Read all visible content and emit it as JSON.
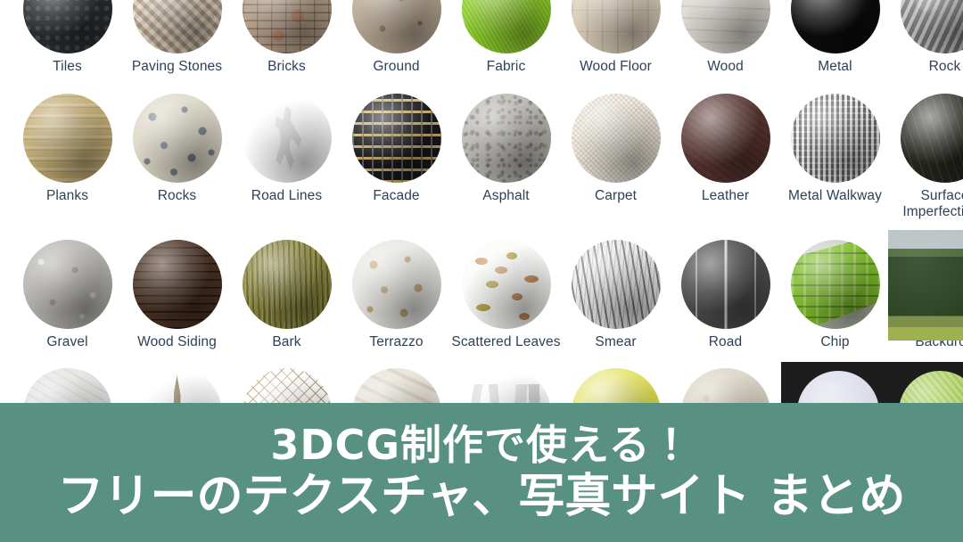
{
  "page": {
    "kind": "texture-library-grid-with-banner",
    "background_color": "#ffffff"
  },
  "grid": {
    "label_color": "#2d4159",
    "columns": 9,
    "items": [
      {
        "label": "Tiles",
        "texture": "t-tiles",
        "shape": "sphere",
        "col": 0,
        "row": 0
      },
      {
        "label": "Paving Stones",
        "texture": "t-paving",
        "shape": "sphere",
        "col": 1,
        "row": 0
      },
      {
        "label": "Bricks",
        "texture": "t-bricks",
        "shape": "sphere",
        "col": 2,
        "row": 0
      },
      {
        "label": "Ground",
        "texture": "t-ground",
        "shape": "sphere",
        "col": 3,
        "row": 0
      },
      {
        "label": "Fabric",
        "texture": "t-fabric",
        "shape": "sphere",
        "col": 4,
        "row": 0
      },
      {
        "label": "Wood Floor",
        "texture": "t-woodfloor",
        "shape": "sphere",
        "col": 5,
        "row": 0
      },
      {
        "label": "Wood",
        "texture": "t-wood",
        "shape": "sphere",
        "col": 6,
        "row": 0
      },
      {
        "label": "Metal",
        "texture": "t-metal",
        "shape": "sphere",
        "col": 7,
        "row": 0
      },
      {
        "label": "Rock",
        "texture": "t-rock",
        "shape": "sphere",
        "col": 8,
        "row": 0
      },
      {
        "label": "Planks",
        "texture": "t-planks",
        "shape": "sphere",
        "col": 0,
        "row": 1
      },
      {
        "label": "Rocks",
        "texture": "t-rocks",
        "shape": "sphere",
        "col": 1,
        "row": 1
      },
      {
        "label": "Road Lines",
        "texture": "t-roadlines",
        "shape": "sphere",
        "col": 2,
        "row": 1
      },
      {
        "label": "Facade",
        "texture": "t-facade",
        "shape": "sphere",
        "col": 3,
        "row": 1
      },
      {
        "label": "Asphalt",
        "texture": "t-asphalt",
        "shape": "sphere",
        "col": 4,
        "row": 1
      },
      {
        "label": "Carpet",
        "texture": "t-carpet",
        "shape": "sphere",
        "col": 5,
        "row": 1
      },
      {
        "label": "Leather",
        "texture": "t-leather",
        "shape": "sphere",
        "col": 6,
        "row": 1
      },
      {
        "label": "Metal Walkway",
        "texture": "t-walkway",
        "shape": "sphere",
        "col": 7,
        "row": 1
      },
      {
        "label": "Surface Imperfections",
        "texture": "t-surfimp",
        "shape": "sphere",
        "col": 8,
        "row": 1,
        "wrap": true
      },
      {
        "label": "Gravel",
        "texture": "t-gravel",
        "shape": "sphere",
        "col": 0,
        "row": 2
      },
      {
        "label": "Wood Siding",
        "texture": "t-woodsiding",
        "shape": "sphere",
        "col": 1,
        "row": 2
      },
      {
        "label": "Bark",
        "texture": "t-bark",
        "shape": "sphere",
        "col": 2,
        "row": 2
      },
      {
        "label": "Terrazzo",
        "texture": "t-terrazzo",
        "shape": "sphere",
        "col": 3,
        "row": 2
      },
      {
        "label": "Scattered Leaves",
        "texture": "t-leaves",
        "shape": "sphere",
        "col": 4,
        "row": 2
      },
      {
        "label": "Smear",
        "texture": "t-smear",
        "shape": "sphere",
        "col": 5,
        "row": 2
      },
      {
        "label": "Road",
        "texture": "t-road",
        "shape": "sphere",
        "col": 6,
        "row": 2
      },
      {
        "label": "Chip",
        "texture": "t-chip",
        "shape": "sphere",
        "col": 7,
        "row": 2
      },
      {
        "label": "Backdrop",
        "texture": "t-backdrop",
        "shape": "photo",
        "col": 8,
        "row": 2
      },
      {
        "label": "",
        "texture": "t-pale",
        "shape": "sphere",
        "col": 0,
        "row": 3
      },
      {
        "label": "",
        "texture": "t-stick",
        "shape": "sphere",
        "col": 1,
        "row": 3
      },
      {
        "label": "",
        "texture": "t-net",
        "shape": "sphere",
        "col": 2,
        "row": 3
      },
      {
        "label": "",
        "texture": "t-marble",
        "shape": "sphere",
        "col": 3,
        "row": 3
      },
      {
        "label": "",
        "texture": "t-shards",
        "shape": "sphere",
        "col": 4,
        "row": 3
      },
      {
        "label": "",
        "texture": "t-ylw",
        "shape": "sphere",
        "col": 5,
        "row": 3
      },
      {
        "label": "",
        "texture": "t-sand",
        "shape": "sphere",
        "col": 6,
        "row": 3
      }
    ]
  },
  "banner": {
    "background_color": "#589181",
    "text_color": "#ffffff",
    "line1": "3DCG制作で使える！",
    "line2": "フリーのテクスチャ、写真サイト まとめ"
  }
}
